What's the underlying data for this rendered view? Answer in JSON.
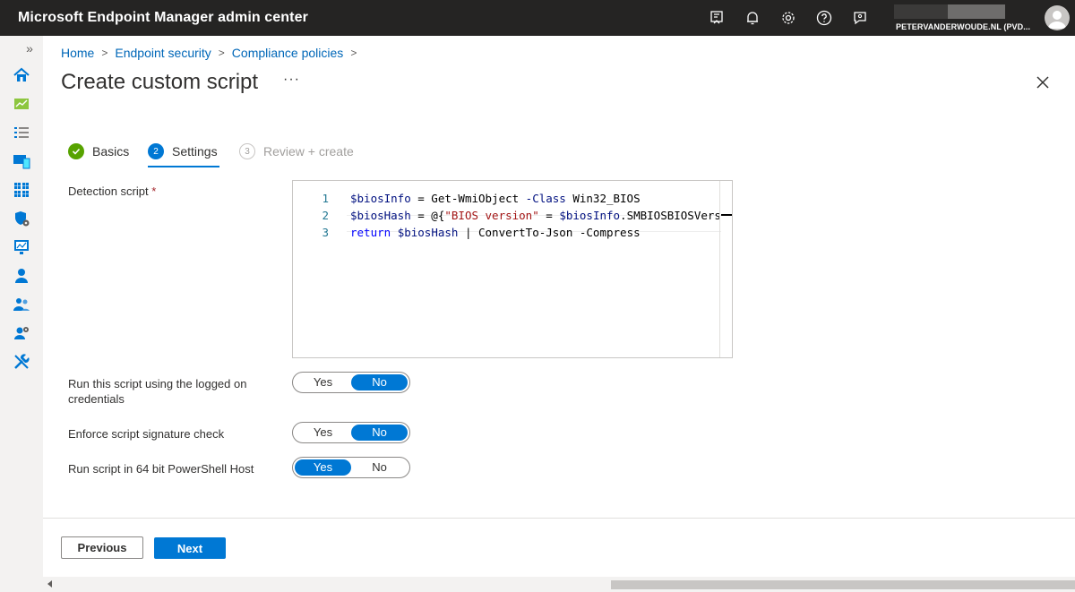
{
  "app": {
    "title": "Microsoft Endpoint Manager admin center",
    "tenant": "PETERVANDERWOUDE.NL (PVD...",
    "top_icons": [
      "remote-help-icon",
      "notification-bell-icon",
      "settings-gear-icon",
      "help-question-icon",
      "feedback-icon"
    ]
  },
  "nav": {
    "expand_glyph": "»",
    "icons": [
      "home-icon",
      "dashboard-icon",
      "all-services-icon",
      "devices-icon",
      "apps-icon",
      "endpoint-security-icon",
      "reports-icon",
      "users-icon",
      "groups-icon",
      "tenant-admin-icon",
      "troubleshooting-icon"
    ]
  },
  "breadcrumb": {
    "items": [
      "Home",
      "Endpoint security",
      "Compliance policies"
    ],
    "separator": ">"
  },
  "page": {
    "title": "Create custom script",
    "more": "···"
  },
  "steps": [
    {
      "label": "Basics",
      "state": "complete",
      "marker": "✓"
    },
    {
      "label": "Settings",
      "state": "active",
      "marker": "2"
    },
    {
      "label": "Review + create",
      "state": "inactive",
      "marker": "3"
    }
  ],
  "form": {
    "detection_label": "Detection script",
    "required_marker": "*",
    "code_lines": [
      {
        "num": "1",
        "parts": [
          [
            "v",
            "$biosInfo"
          ],
          [
            "op",
            " = Get-WmiObject "
          ],
          [
            "v",
            "-Class"
          ],
          [
            "op",
            " Win32_BIOS"
          ]
        ]
      },
      {
        "num": "2",
        "parts": [
          [
            "v",
            "$biosHash"
          ],
          [
            "op",
            " = @{"
          ],
          [
            "s",
            "\"BIOS version\""
          ],
          [
            "op",
            " = "
          ],
          [
            "v",
            "$biosInfo"
          ],
          [
            "op",
            ".SMBIOSBIOSVersion"
          ]
        ]
      },
      {
        "num": "3",
        "parts": [
          [
            "kw",
            "return"
          ],
          [
            "op",
            " "
          ],
          [
            "v",
            "$biosHash"
          ],
          [
            "op",
            " | ConvertTo-Json -Compress"
          ]
        ]
      }
    ],
    "run_logged_on_label": "Run this script using the logged on credentials",
    "signature_label": "Enforce script signature check",
    "run_64bit_label": "Run script in 64 bit PowerShell Host",
    "toggle_yes": "Yes",
    "toggle_no": "No",
    "run_logged_on_value": "No",
    "signature_value": "No",
    "run_64bit_value": "Yes"
  },
  "footer": {
    "previous": "Previous",
    "next": "Next"
  },
  "colors": {
    "accent": "#0078d4",
    "topbar": "#252423",
    "success": "#57a300",
    "link": "#0067b8"
  }
}
